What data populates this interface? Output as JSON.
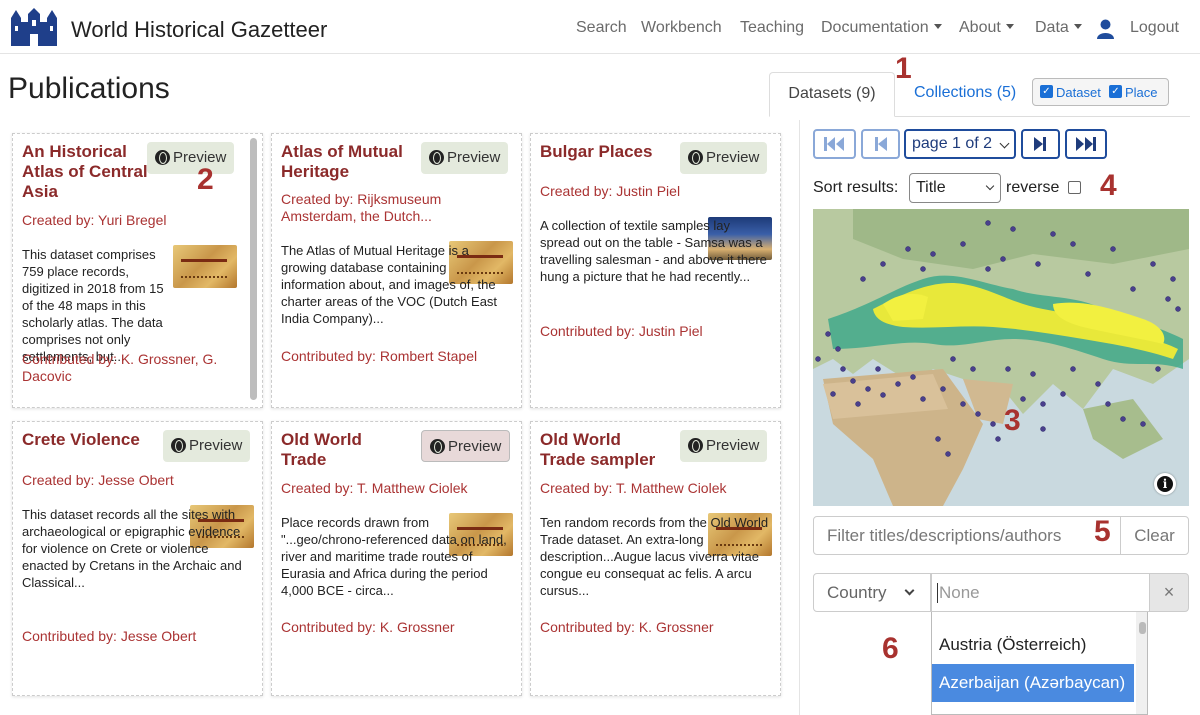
{
  "brand": "World Historical Gazetteer",
  "nav": {
    "search": "Search",
    "workbench": "Workbench",
    "teaching": "Teaching",
    "documentation": "Documentation",
    "about": "About",
    "data": "Data",
    "logout": "Logout"
  },
  "page_title": "Publications",
  "tabs": {
    "datasets": "Datasets (9)",
    "collections": "Collections (5)"
  },
  "type_filter": {
    "dataset": "Dataset",
    "place": "Place"
  },
  "cards": [
    {
      "title": "An Historical Atlas of Central Asia",
      "preview": "Preview",
      "creator": "Created by: Yuri Bregel",
      "description": "This dataset comprises 759 place records, digitized in 2018 from 15 of the 48 maps in this scholarly atlas. The data comprises not only settlements, but...",
      "contributor": "Contributed by: K. Grossner, G. Dacovic"
    },
    {
      "title": "Atlas of Mutual Heritage",
      "preview": "Preview",
      "creator": "Created by: Rijksmuseum Amsterdam, the Dutch...",
      "description": "The Atlas of Mutual Heritage is a growing database containing information about, and images of, the charter areas of the VOC (Dutch East India Company)...",
      "contributor": "Contributed by: Rombert Stapel"
    },
    {
      "title": "Bulgar Places",
      "preview": "Preview",
      "creator": "Created by: Justin Piel",
      "description": "A collection of textile samples lay spread out on the table - Samsa was a travelling salesman - and above it there hung a picture that he had recently...",
      "contributor": "Contributed by: Justin Piel"
    },
    {
      "title": "Crete Violence",
      "preview": "Preview",
      "creator": "Created by: Jesse Obert",
      "description": "This dataset records all the sites with archaeological or epigraphic evidence for violence on Crete or violence enacted by Cretans in the Archaic and Classical...",
      "contributor": "Contributed by: Jesse Obert"
    },
    {
      "title": "Old World Trade",
      "preview": "Preview",
      "creator": "Created by: T. Matthew Ciolek",
      "description": "Place records drawn from \"...geo/chrono-referenced data on land, river and maritime trade routes of Eurasia and Africa during the period 4,000 BCE - circa...",
      "contributor": "Contributed by: K. Grossner"
    },
    {
      "title": "Old World Trade sampler",
      "preview": "Preview",
      "creator": "Created by: T. Matthew Ciolek",
      "description": "Ten random records from the Old World Trade dataset. An extra-long description...Augue lacus viverra vitae congue eu consequat ac felis. A arcu cursus...",
      "contributor": "Contributed by: K. Grossner"
    }
  ],
  "pagination": {
    "page_label": "page 1 of 2"
  },
  "sort": {
    "label": "Sort results:",
    "value": "Title",
    "reverse_label": "reverse",
    "reverse_checked": false
  },
  "filter": {
    "placeholder": "Filter titles/descriptions/authors",
    "clear": "Clear"
  },
  "country": {
    "select": "Country",
    "placeholder": "None",
    "clear_icon": "×",
    "options": [
      "Austria (Österreich)",
      "Azerbaijan (Azərbaycan)"
    ],
    "selected": "Azerbaijan (Azərbaycan)"
  },
  "annotations": [
    "1",
    "2",
    "3",
    "4",
    "5",
    "6"
  ],
  "colors": {
    "title_red": "#8b2a2a",
    "link_blue": "#1a6fd6",
    "nav_blue": "#1f4c9c",
    "highlight": "#4a8ae0"
  }
}
